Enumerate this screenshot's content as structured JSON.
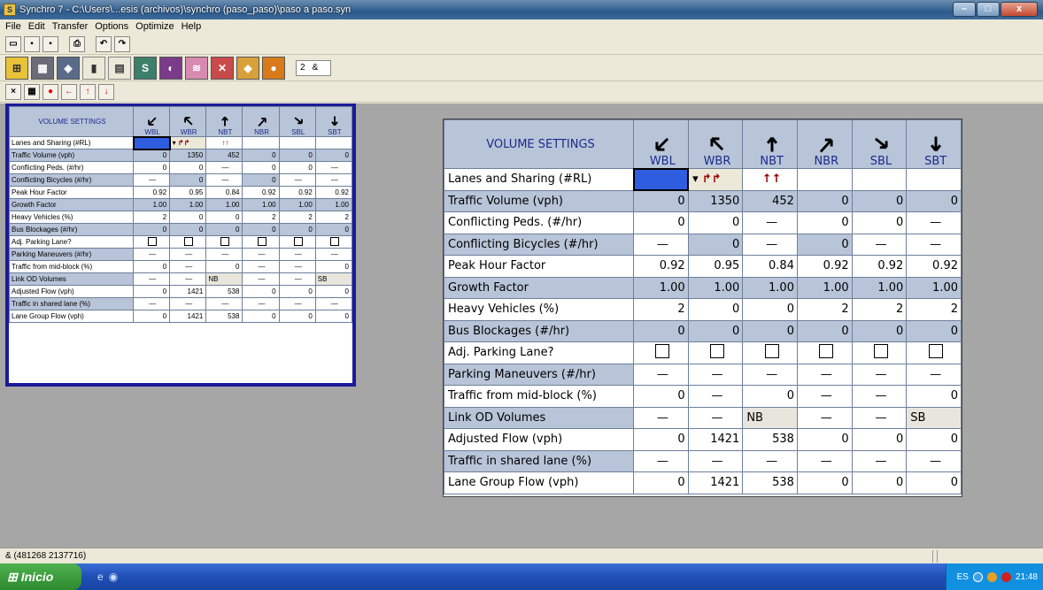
{
  "window": {
    "title": "Synchro 7 - C:\\Users\\...esis (archivos)\\synchro (paso_paso)\\paso a paso.syn",
    "app_icon": "synchro-icon"
  },
  "menu": [
    "File",
    "Edit",
    "Transfer",
    "Options",
    "Optimize",
    "Help"
  ],
  "toolbar": {
    "node_spin_value": "2",
    "node_spin_suffix": "&"
  },
  "volume_settings": {
    "title": "VOLUME SETTINGS",
    "directions": [
      "WBL",
      "WBR",
      "NBT",
      "NBR",
      "SBL",
      "SBT"
    ],
    "rows": [
      {
        "label": "Lanes and Sharing (#RL)",
        "cells": [
          "",
          "",
          "↱↱",
          "↑↑",
          "",
          ""
        ],
        "type": "lanes"
      },
      {
        "label": "Traffic Volume (vph)",
        "cells": [
          "0",
          "1350",
          "452",
          "0",
          "0",
          "0"
        ]
      },
      {
        "label": "Conflicting Peds. (#/hr)",
        "cells": [
          "0",
          "0",
          "—",
          "0",
          "0",
          "—"
        ]
      },
      {
        "label": "Conflicting Bicycles (#/hr)",
        "cells": [
          "—",
          "0",
          "—",
          "0",
          "—",
          "—"
        ]
      },
      {
        "label": "Peak Hour Factor",
        "cells": [
          "0.92",
          "0.95",
          "0.84",
          "0.92",
          "0.92",
          "0.92"
        ]
      },
      {
        "label": "Growth Factor",
        "cells": [
          "1.00",
          "1.00",
          "1.00",
          "1.00",
          "1.00",
          "1.00"
        ]
      },
      {
        "label": "Heavy Vehicles (%)",
        "cells": [
          "2",
          "0",
          "0",
          "2",
          "2",
          "2"
        ]
      },
      {
        "label": "Bus Blockages (#/hr)",
        "cells": [
          "0",
          "0",
          "0",
          "0",
          "0",
          "0"
        ]
      },
      {
        "label": "Adj. Parking Lane?",
        "cells": [
          "",
          "",
          "",
          "",
          "",
          ""
        ],
        "type": "checkbox"
      },
      {
        "label": "Parking Maneuvers (#/hr)",
        "cells": [
          "—",
          "—",
          "—",
          "—",
          "—",
          "—"
        ]
      },
      {
        "label": "Traffic from mid-block (%)",
        "cells": [
          "0",
          "—",
          "0",
          "—",
          "—",
          "0"
        ]
      },
      {
        "label": "Link OD Volumes",
        "cells": [
          "—",
          "—",
          "NB",
          "—",
          "—",
          "SB"
        ],
        "type": "od"
      },
      {
        "label": "Adjusted Flow (vph)",
        "cells": [
          "0",
          "1421",
          "538",
          "0",
          "0",
          "0"
        ]
      },
      {
        "label": "Traffic in shared lane (%)",
        "cells": [
          "—",
          "—",
          "—",
          "—",
          "—",
          "—"
        ]
      },
      {
        "label": "Lane Group Flow (vph)",
        "cells": [
          "0",
          "1421",
          "538",
          "0",
          "0",
          "0"
        ]
      }
    ]
  },
  "status": {
    "coords": "& (481268 2137716)"
  },
  "taskbar": {
    "start_label": "Inicio",
    "lang": "ES",
    "clock": "21:48"
  }
}
